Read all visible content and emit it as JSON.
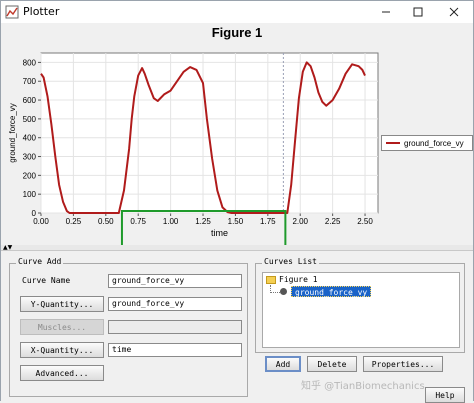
{
  "window": {
    "title": "Plotter"
  },
  "icons": {
    "app": "plotter-app-icon",
    "minimize": "minimize-icon",
    "maximize": "maximize-icon",
    "close": "close-icon"
  },
  "colors": {
    "series": "#b01b1b",
    "highlight_box": "#1e9a2b",
    "selection": "#1a63c8"
  },
  "chart_data": {
    "type": "line",
    "title": "Figure 1",
    "xlabel": "time",
    "ylabel": "ground_force_vy",
    "xlim": [
      0.0,
      2.6
    ],
    "ylim": [
      0,
      850
    ],
    "xticks": [
      "0.00",
      "0.25",
      "0.50",
      "0.75",
      "1.00",
      "1.25",
      "1.50",
      "1.75",
      "2.00",
      "2.25",
      "2.50"
    ],
    "yticks": [
      "0",
      "100",
      "200",
      "300",
      "400",
      "500",
      "600",
      "700",
      "800"
    ],
    "grid": true,
    "legend_position": "right",
    "series": [
      {
        "name": "ground_force_vy",
        "x": [
          0.0,
          0.02,
          0.05,
          0.08,
          0.11,
          0.14,
          0.17,
          0.2,
          0.22,
          0.6,
          0.64,
          0.68,
          0.7,
          0.72,
          0.75,
          0.78,
          0.8,
          0.83,
          0.87,
          0.9,
          0.95,
          1.0,
          1.05,
          1.1,
          1.15,
          1.2,
          1.25,
          1.28,
          1.32,
          1.36,
          1.4,
          1.44,
          1.47,
          1.9,
          1.93,
          1.96,
          1.99,
          2.02,
          2.05,
          2.08,
          2.11,
          2.14,
          2.17,
          2.2,
          2.25,
          2.3,
          2.35,
          2.4,
          2.45,
          2.48,
          2.5
        ],
        "y": [
          740,
          720,
          620,
          470,
          300,
          150,
          60,
          10,
          0,
          0,
          120,
          340,
          500,
          620,
          730,
          770,
          740,
          680,
          610,
          595,
          630,
          650,
          700,
          750,
          775,
          760,
          690,
          500,
          290,
          120,
          30,
          5,
          0,
          0,
          150,
          380,
          610,
          750,
          800,
          780,
          720,
          640,
          590,
          570,
          600,
          660,
          740,
          790,
          780,
          760,
          730
        ]
      }
    ],
    "annotations": {
      "vline_x": 1.87,
      "highlight_range": [
        0.64,
        1.87
      ]
    }
  },
  "lower": {
    "curve_add": {
      "title": "Curve Add",
      "curve_name_label": "Curve Name",
      "curve_name_value": "ground_force_vy",
      "y_quantity_button": "Y-Quantity...",
      "y_quantity_value": "ground_force_vy",
      "muscles_button": "Muscles...",
      "muscles_value": "",
      "x_quantity_button": "X-Quantity...",
      "x_quantity_value": "time",
      "advanced_button": "Advanced..."
    },
    "curves_list": {
      "title": "Curves List",
      "root": "Figure 1",
      "child": "ground_force_vy"
    },
    "actions": {
      "add": "Add",
      "delete": "Delete",
      "properties": "Properties...",
      "help": "Help"
    }
  },
  "watermark": "知乎 @TianBiomechanics"
}
